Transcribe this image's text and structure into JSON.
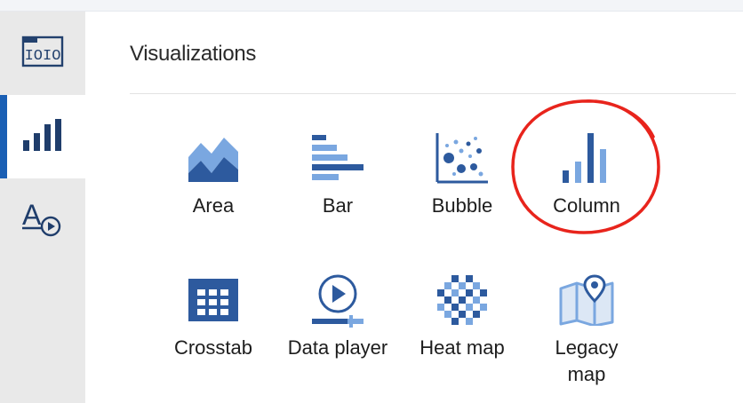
{
  "sidebar": {
    "items": [
      {
        "icon": "data-source-icon",
        "active": false
      },
      {
        "icon": "visualizations-icon",
        "active": true
      },
      {
        "icon": "format-animation-icon",
        "active": false
      }
    ]
  },
  "main": {
    "title": "Visualizations",
    "tiles": [
      {
        "label": "Area",
        "icon": "area-chart-icon"
      },
      {
        "label": "Bar",
        "icon": "bar-chart-icon"
      },
      {
        "label": "Bubble",
        "icon": "bubble-chart-icon"
      },
      {
        "label": "Column",
        "icon": "column-chart-icon"
      },
      {
        "label": "Crosstab",
        "icon": "crosstab-icon"
      },
      {
        "label": "Data player",
        "icon": "data-player-icon"
      },
      {
        "label": "Heat map",
        "icon": "heat-map-icon"
      },
      {
        "label": "Legacy map",
        "icon": "legacy-map-icon"
      }
    ]
  },
  "colors": {
    "accent": "#1a5fb4",
    "icon_dark": "#2d5a9e",
    "icon_light": "#7aa7e0",
    "highlight_ring": "#e8241c"
  }
}
